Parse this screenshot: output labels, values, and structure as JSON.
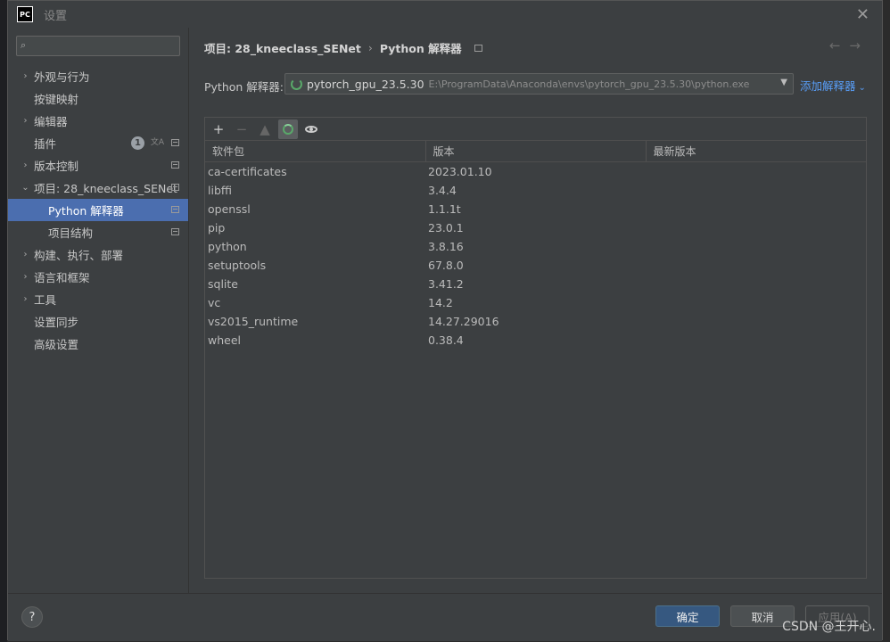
{
  "window": {
    "app_icon": "PC",
    "title": "设置",
    "close": "✕"
  },
  "sidebar": {
    "search_placeholder": "",
    "items": [
      {
        "label": "外观与行为",
        "expandable": true
      },
      {
        "label": "按键映射",
        "expandable": false
      },
      {
        "label": "编辑器",
        "expandable": true
      },
      {
        "label": "插件",
        "expandable": false,
        "badge": "1"
      },
      {
        "label": "版本控制",
        "expandable": true
      },
      {
        "label": "项目: 28_kneeclass_SENet",
        "expandable": true,
        "expanded": true
      },
      {
        "label": "Python 解释器",
        "child": true,
        "active": true
      },
      {
        "label": "项目结构",
        "child": true
      },
      {
        "label": "构建、执行、部署",
        "expandable": true
      },
      {
        "label": "语言和框架",
        "expandable": true
      },
      {
        "label": "工具",
        "expandable": true
      },
      {
        "label": "设置同步",
        "expandable": false
      },
      {
        "label": "高级设置",
        "expandable": false
      }
    ]
  },
  "breadcrumb": {
    "project": "项目: 28_kneeclass_SENet",
    "separator": "›",
    "page": "Python 解释器"
  },
  "interpreter": {
    "label": "Python 解释器:",
    "name": "pytorch_gpu_23.5.30",
    "path": "E:\\ProgramData\\Anaconda\\envs\\pytorch_gpu_23.5.30\\python.exe",
    "add_label": "添加解释器"
  },
  "toolbar": {
    "add": "+",
    "remove": "−",
    "upgrade": "▲"
  },
  "table": {
    "headers": [
      "软件包",
      "版本",
      "最新版本"
    ],
    "rows": [
      [
        "ca-certificates",
        "2023.01.10",
        ""
      ],
      [
        "libffi",
        "3.4.4",
        ""
      ],
      [
        "openssl",
        "1.1.1t",
        ""
      ],
      [
        "pip",
        "23.0.1",
        ""
      ],
      [
        "python",
        "3.8.16",
        ""
      ],
      [
        "setuptools",
        "67.8.0",
        ""
      ],
      [
        "sqlite",
        "3.41.2",
        ""
      ],
      [
        "vc",
        "14.2",
        ""
      ],
      [
        "vs2015_runtime",
        "14.27.29016",
        ""
      ],
      [
        "wheel",
        "0.38.4",
        ""
      ]
    ]
  },
  "footer": {
    "help": "?",
    "ok": "确定",
    "cancel": "取消",
    "apply": "应用(A)"
  },
  "watermark": "CSDN @王开心."
}
